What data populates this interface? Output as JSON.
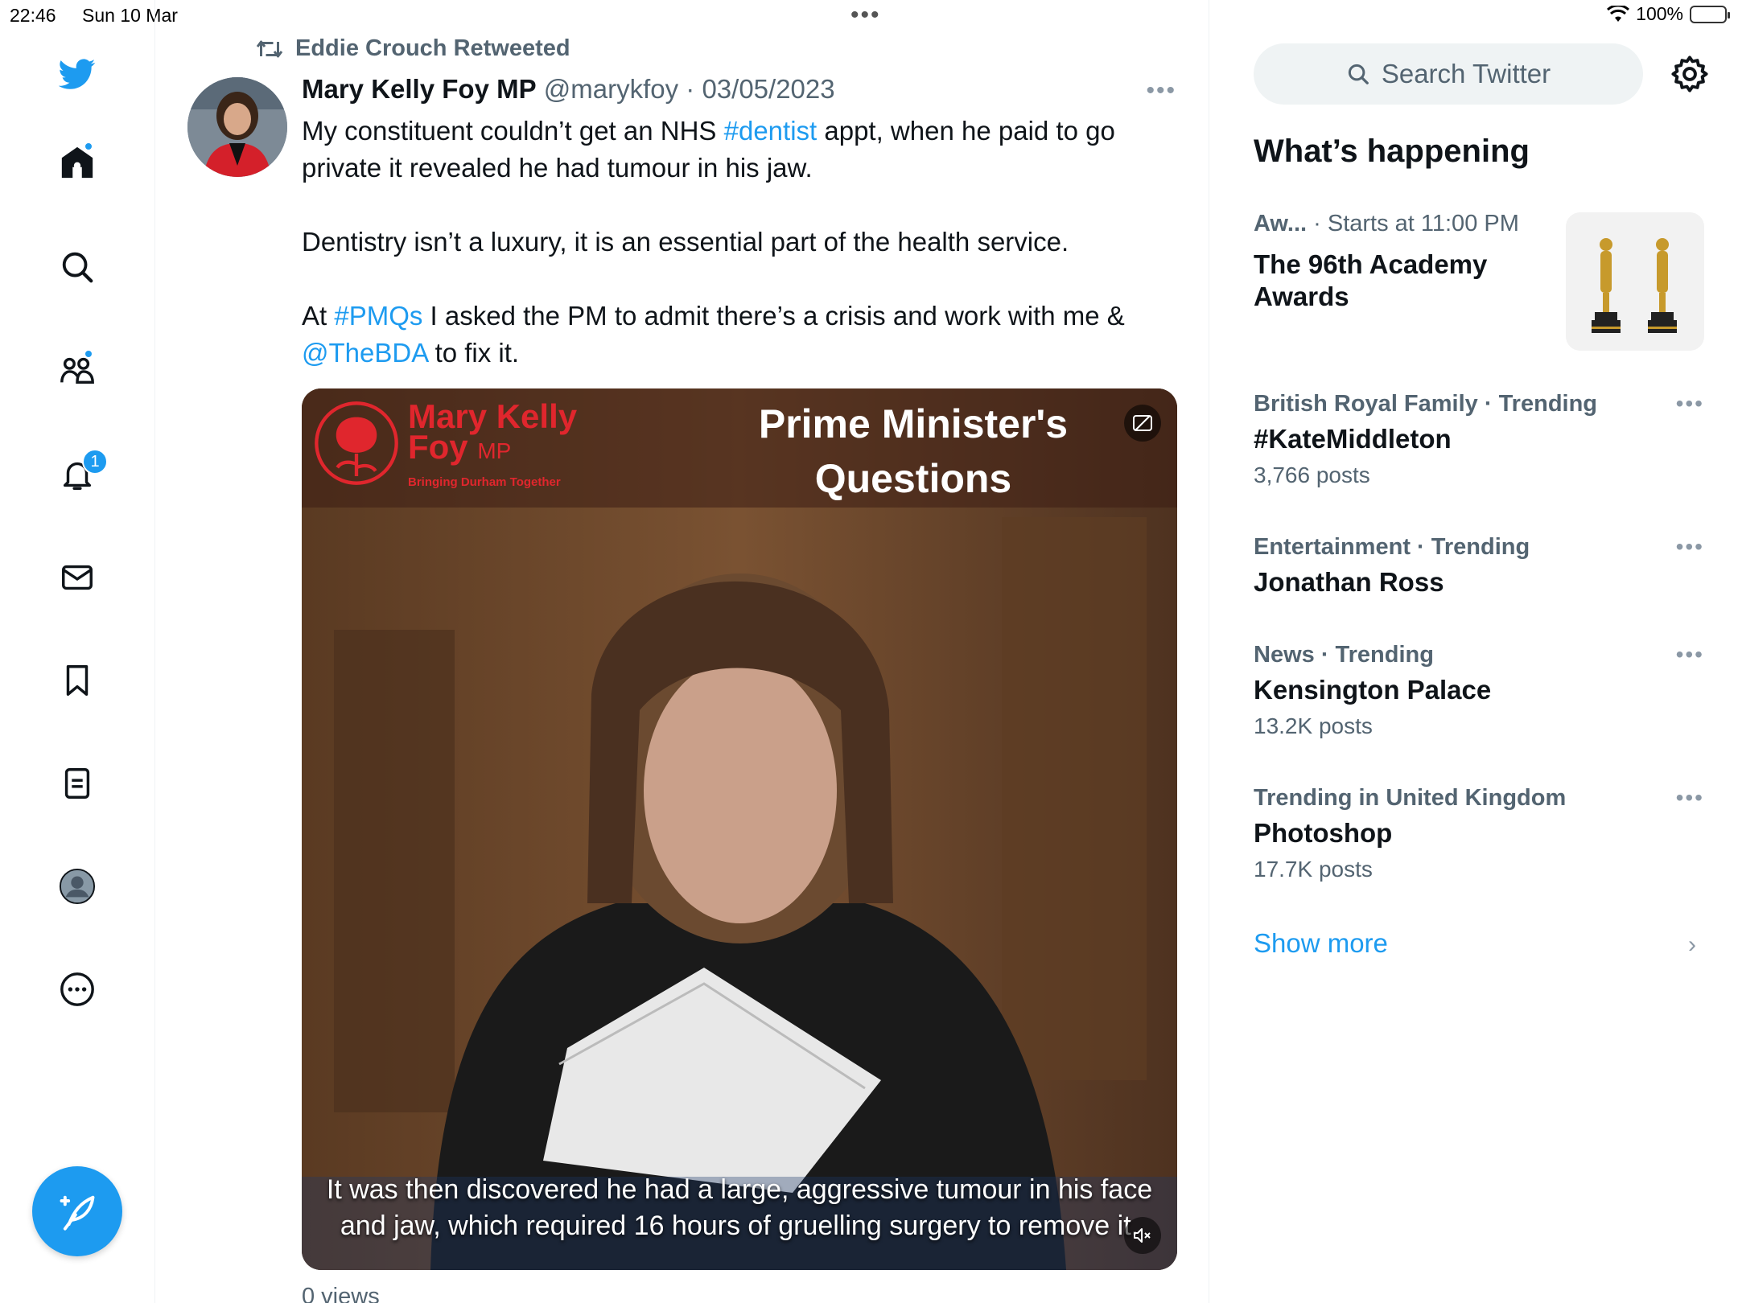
{
  "status_bar": {
    "time": "22:46",
    "date": "Sun 10 Mar",
    "battery": "100%"
  },
  "nav": {
    "notification_count": "1"
  },
  "tweet": {
    "retweeted_by": "Eddie Crouch Retweeted",
    "author_name": "Mary Kelly Foy MP",
    "author_handle": "@marykfoy",
    "date": "03/05/2023",
    "text": {
      "p1_before": "My constituent couldn’t get an NHS ",
      "p1_hashtag": "#dentist",
      "p1_after": " appt, when he paid to go private it revealed he had tumour in his jaw.",
      "p2": "Dentistry isn’t a luxury, it is an essential part of the health service.",
      "p3_before": "At ",
      "p3_hashtag": "#PMQs",
      "p3_middle": " I asked the PM to admit there’s a crisis and work with me & ",
      "p3_mention": "@TheBDA",
      "p3_after": " to fix it."
    },
    "media": {
      "logo_name_line1": "Mary Kelly",
      "logo_name_line2": "Foy",
      "logo_mp": "MP",
      "logo_tagline": "Bringing Durham Together",
      "title": "Prime Minister's Questions",
      "caption": "It was then discovered he had a large, aggressive tumour in his face and jaw, which required 16 hours of gruelling surgery to remove it."
    },
    "views": "0 views"
  },
  "sidebar": {
    "search_placeholder": "Search Twitter",
    "heading": "What’s happening",
    "event": {
      "category": "Aw...",
      "time": "· Starts at 11:00 PM",
      "title": "The 96th Academy Awards"
    },
    "trends": [
      {
        "category": "British Royal Family · Trending",
        "name": "#KateMiddleton",
        "count": "3,766 posts"
      },
      {
        "category": "Entertainment · Trending",
        "name": "Jonathan Ross",
        "count": ""
      },
      {
        "category": "News · Trending",
        "name": "Kensington Palace",
        "count": "13.2K posts"
      },
      {
        "category": "Trending in United Kingdom",
        "name": "Photoshop",
        "count": "17.7K posts"
      }
    ],
    "show_more": "Show more"
  },
  "colors": {
    "accent": "#1d9bf0",
    "secondary_text": "#536471",
    "text": "#0f1419"
  }
}
